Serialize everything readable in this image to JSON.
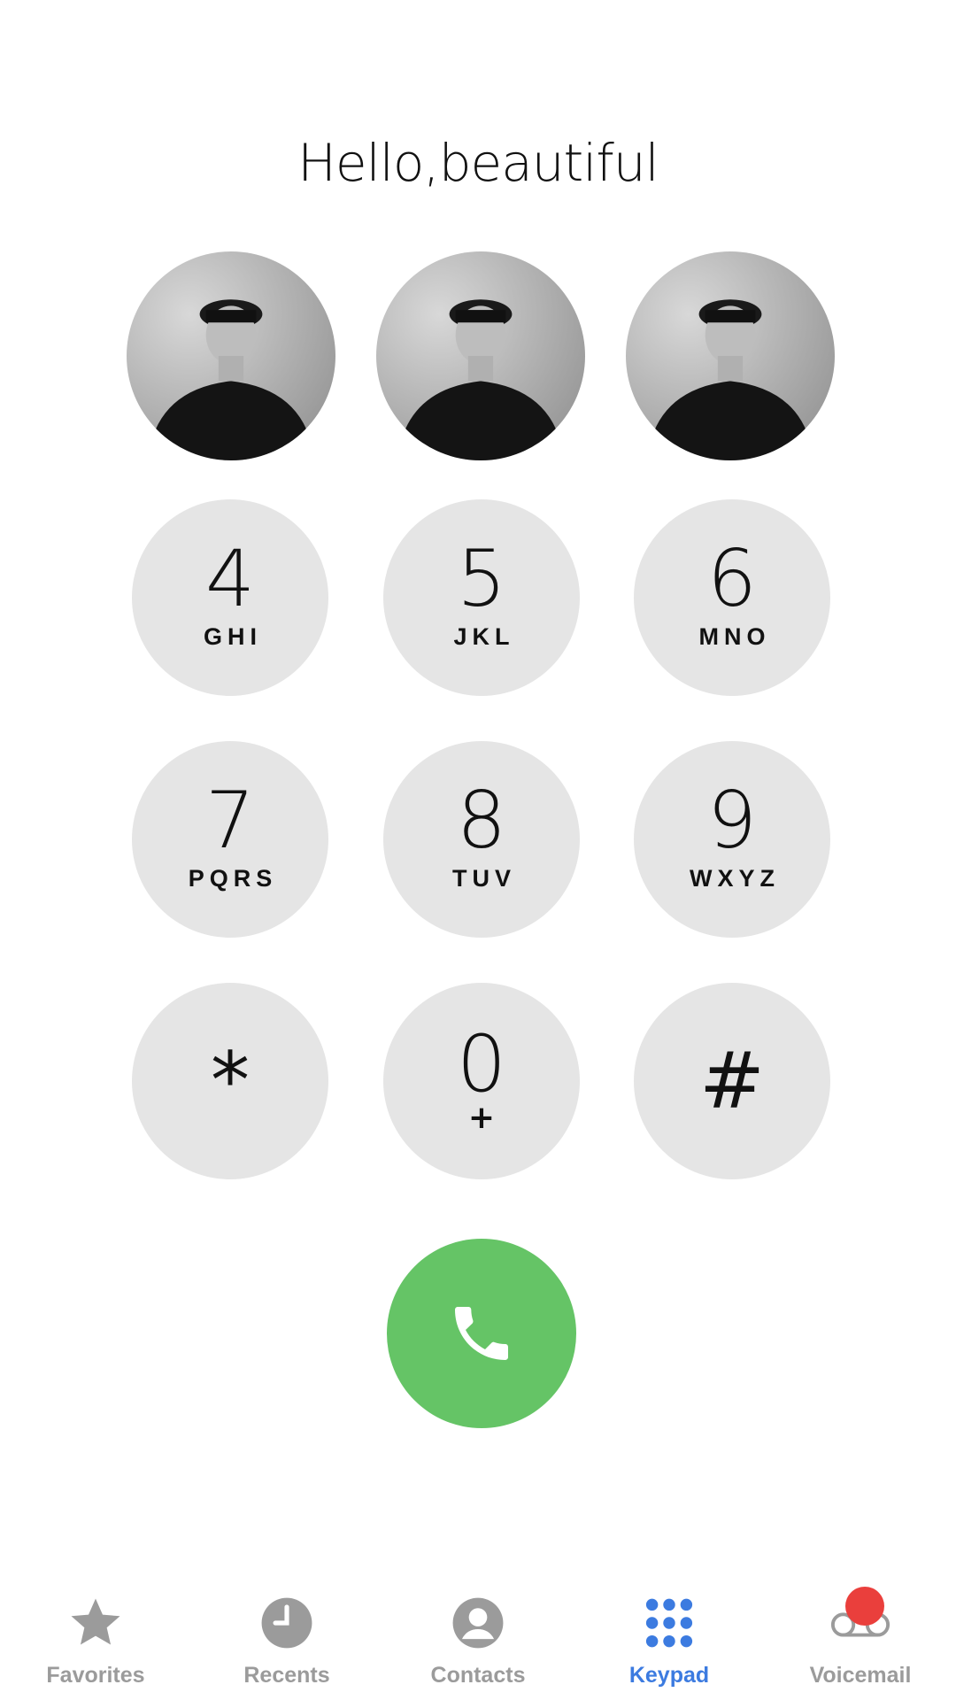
{
  "greeting": "Hello,beautiful",
  "favorites": [
    {
      "name": "favorite-contact-1"
    },
    {
      "name": "favorite-contact-2"
    },
    {
      "name": "favorite-contact-3"
    }
  ],
  "keypad": {
    "keys": [
      {
        "digit": "4",
        "letters": "GHI"
      },
      {
        "digit": "5",
        "letters": "JKL"
      },
      {
        "digit": "6",
        "letters": "MNO"
      },
      {
        "digit": "7",
        "letters": "PQRS"
      },
      {
        "digit": "8",
        "letters": "TUV"
      },
      {
        "digit": "9",
        "letters": "WXYZ"
      },
      {
        "digit": "*",
        "letters": ""
      },
      {
        "digit": "0",
        "letters": "+"
      },
      {
        "digit": "#",
        "letters": ""
      }
    ]
  },
  "call_button": {
    "icon": "phone-icon",
    "color": "#65c466"
  },
  "tabbar": {
    "tabs": [
      {
        "label": "Favorites",
        "icon": "star-icon",
        "active": false
      },
      {
        "label": "Recents",
        "icon": "clock-icon",
        "active": false
      },
      {
        "label": "Contacts",
        "icon": "person-icon",
        "active": false
      },
      {
        "label": "Keypad",
        "icon": "keypad-icon",
        "active": true
      },
      {
        "label": "Voicemail",
        "icon": "voicemail-icon",
        "active": false
      }
    ],
    "active_color": "#3c7be0",
    "inactive_color": "#9b9b9b",
    "badge_color": "#ea3f3c"
  }
}
